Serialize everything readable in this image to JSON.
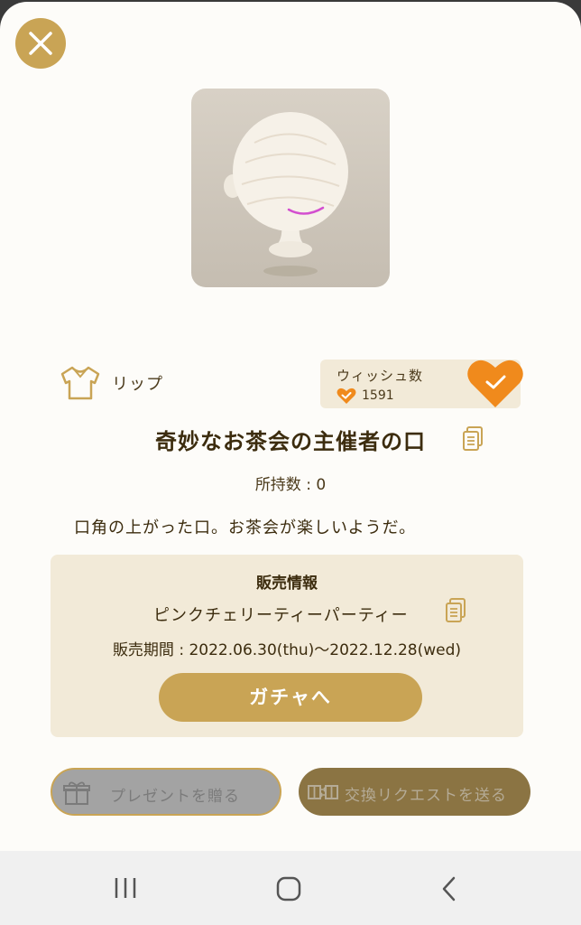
{
  "item": {
    "category_label": "リップ",
    "title": "奇妙なお茶会の主催者の口",
    "owned": "所持数 : 0",
    "description": "口角の上がった口。お茶会が楽しいようだ。"
  },
  "wish": {
    "label": "ウィッシュ数",
    "count": "1591",
    "active": true,
    "accent_color": "#f08a1c"
  },
  "sales": {
    "heading": "販売情報",
    "event_name": "ピンクチェリーティーパーティー",
    "period": "販売期間 : 2022.06.30(thu)〜2022.12.28(wed)",
    "gacha_button": "ガチャへ"
  },
  "actions": {
    "gift_label": "プレゼントを贈る",
    "trade_label": "交換リクエストを送る",
    "gift_enabled": false,
    "trade_enabled": false
  },
  "icons": {
    "close": "close-icon",
    "category": "shirt-icon",
    "copy": "copy-icon",
    "gift": "gift-icon",
    "trade": "trade-icon",
    "wish": "heart-check-icon"
  },
  "navbar": [
    "recent-apps",
    "home",
    "back"
  ],
  "colors": {
    "gold": "#c9a455",
    "text_brown": "#3c2c0e",
    "panel_beige": "#f2ead8",
    "heart_orange": "#f08a1c",
    "lip_pink": "#d34fcf"
  }
}
